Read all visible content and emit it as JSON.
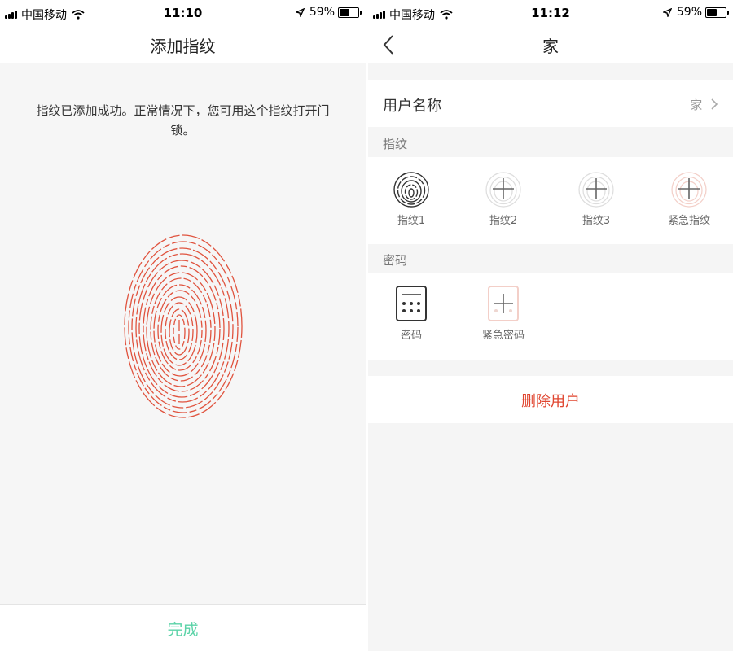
{
  "left_screen": {
    "status": {
      "carrier": "中国移动",
      "time": "11:10",
      "battery": "59%",
      "battery_level": 0.59
    },
    "title": "添加指纹",
    "message": "指纹已添加成功。正常情况下，您可用这个指纹打开门锁。",
    "done_label": "完成",
    "colors": {
      "fingerprint": "#e0533e",
      "done": "#5cd3a8"
    }
  },
  "right_screen": {
    "status": {
      "carrier": "中国移动",
      "time": "11:12",
      "battery": "59%",
      "battery_level": 0.59
    },
    "title": "家",
    "back_icon": "chevron-left-icon",
    "user_name_label": "用户名称",
    "user_name_value": "家",
    "fingerprint_section": "指纹",
    "fingerprints": [
      {
        "label": "指纹1",
        "state": "added"
      },
      {
        "label": "指纹2",
        "state": "empty"
      },
      {
        "label": "指纹3",
        "state": "empty"
      },
      {
        "label": "紧急指纹",
        "state": "empty-emergency"
      }
    ],
    "password_section": "密码",
    "passwords": [
      {
        "label": "密码",
        "state": "added"
      },
      {
        "label": "紧急密码",
        "state": "empty-emergency"
      }
    ],
    "delete_label": "删除用户",
    "colors": {
      "danger": "#e0452f"
    }
  }
}
